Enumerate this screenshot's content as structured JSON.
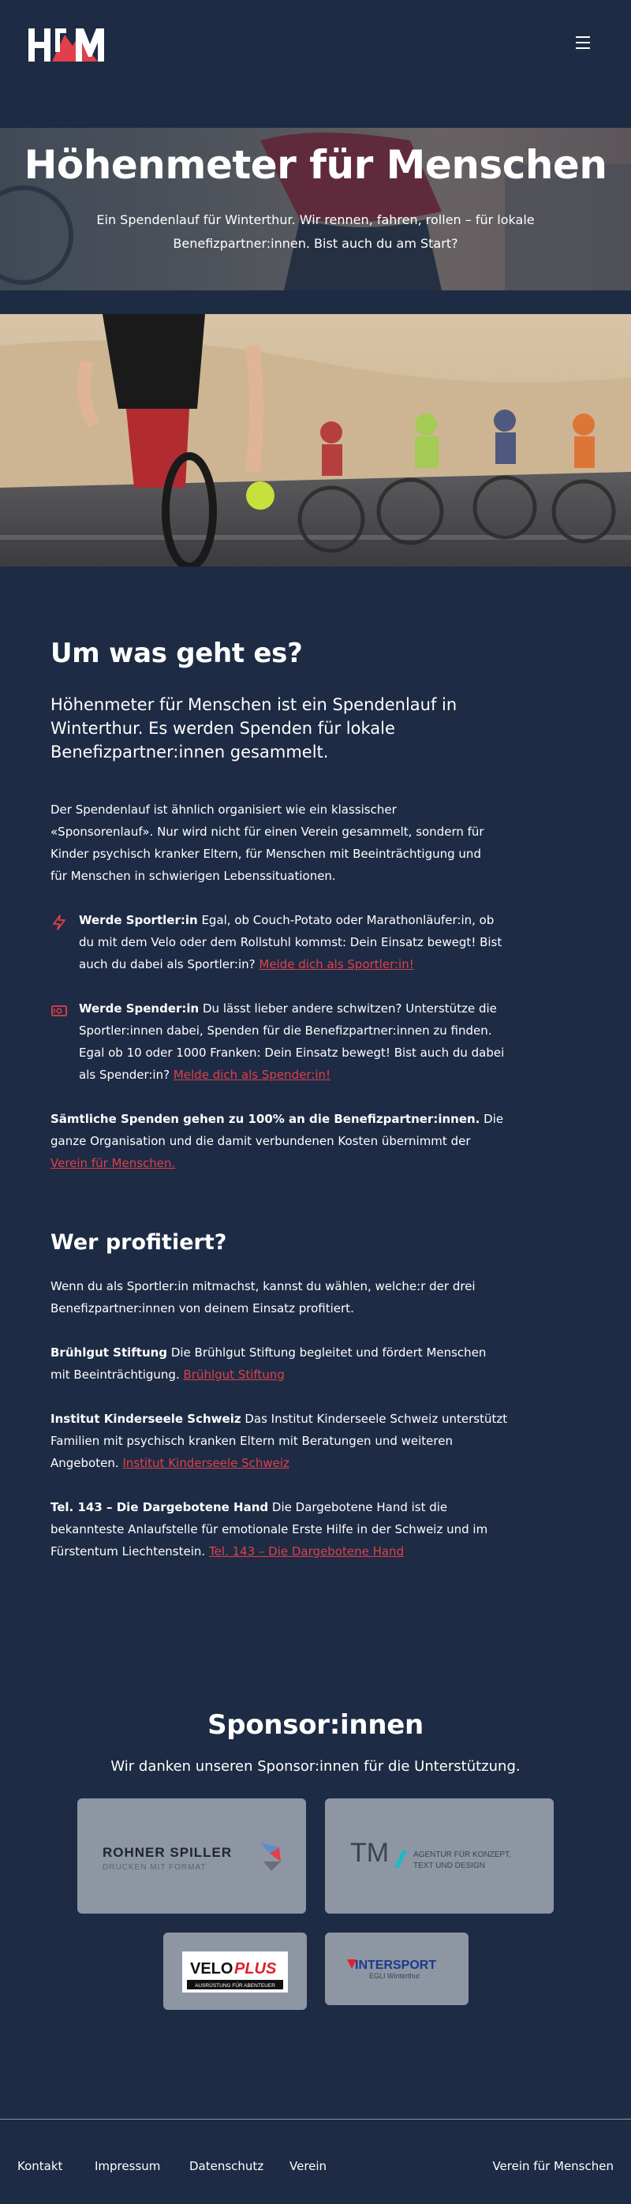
{
  "header": {
    "logo_text": "HfM",
    "menu_icon": "hamburger-icon"
  },
  "hero": {
    "title": "Höhenmeter für Menschen",
    "subtitle": "Ein Spendenlauf für Winterthur. Wir rennen, fahren, rollen – für lokale Benefizpartner:innen. Bist auch du am Start?"
  },
  "about": {
    "heading": "Um was geht es?",
    "lead": "Höhenmeter für Menschen ist ein Spendenlauf in Winterthur. Es werden Spenden für lokale Benefizpartner:innen gesammelt.",
    "paragraph": "Der Spendenlauf ist ähnlich organisiert wie ein klassischer «Sponsorenlauf». Nur wird nicht für einen Verein gesammelt, sondern für Kinder psychisch kranker Eltern, für Menschen mit Beeinträchtigung und für Menschen in schwierigen Lebenssituationen.",
    "features": [
      {
        "icon": "lightning-icon",
        "title": "Werde Sportler:in",
        "text": " Egal, ob Couch-Potato oder Marathonläufer:in, ob du mit dem Velo oder dem Rollstuhl kommst: Dein Einsatz bewegt! Bist auch du dabei als Sportler:in? ",
        "link": "Melde dich als Sportler:in!"
      },
      {
        "icon": "money-icon",
        "title": "Werde Spender:in",
        "text": " Du lässt lieber andere schwitzen? Unterstütze die Sportler:innen dabei, Spenden für die Benefizpartner:innen zu finden. Egal ob 10 oder 1000 Franken: Dein Einsatz bewegt! Bist auch du dabei als Spender:in? ",
        "link": "Melde dich als Spender:in!"
      }
    ],
    "donation_bold": "Sämtliche Spenden gehen zu 100% an die Benefizpartner:innen.",
    "donation_text": " Die ganze Organisation und die damit verbundenen Kosten übernimmt der ",
    "donation_link": "Verein für Menschen."
  },
  "beneficiaries": {
    "heading": "Wer profitiert?",
    "intro": "Wenn du als Sportler:in mitmachst, kannst du wählen, welche:r der drei Benefizpartner:innen von deinem Einsatz profitiert.",
    "items": [
      {
        "name": "Brühlgut Stiftung",
        "text": " Die Brühlgut Stiftung begleitet und fördert Menschen mit Beeinträchtigung. ",
        "link": "Brühlgut Stiftung"
      },
      {
        "name": "Institut Kinderseele Schweiz",
        "text": " Das Institut Kinderseele Schweiz unterstützt Familien mit psychisch kranken Eltern mit Beratungen und weiteren Angeboten. ",
        "link": "Institut Kinderseele Schweiz"
      },
      {
        "name": "Tel. 143 – Die Dargebotene Hand",
        "text": " Die Dargebotene Hand ist die bekannteste Anlaufstelle für emotionale Erste Hilfe in der Schweiz und im Fürstentum Liechtenstein. ",
        "link": "Tel. 143 – Die Dargebotene Hand"
      }
    ]
  },
  "sponsors": {
    "heading": "Sponsor:innen",
    "subtitle": "Wir danken unseren Sponsor:innen für die Unterstützung.",
    "logos": [
      {
        "line1": "ROHNER SPILLER",
        "line2": "DRUCKEN MIT FORMAT"
      },
      {
        "mark": "TM",
        "line1": "AGENTUR FÜR KONZEPT,",
        "line2": "TEXT UND DESIGN"
      },
      {
        "line1a": "VELO",
        "line1b": "PLUS",
        "line2": "AUSRÜSTUNG FÜR ABENTEUER"
      },
      {
        "line1": "INTERSPORT",
        "line2": "EGLI Winterthur"
      }
    ]
  },
  "footer": {
    "links": [
      "Kontakt",
      "Impressum",
      "Datenschutz",
      "Verein"
    ],
    "right": "Verein für Menschen"
  },
  "colors": {
    "background": "#1d2b44",
    "accent": "#e0404a",
    "card": "#8e96a3"
  }
}
